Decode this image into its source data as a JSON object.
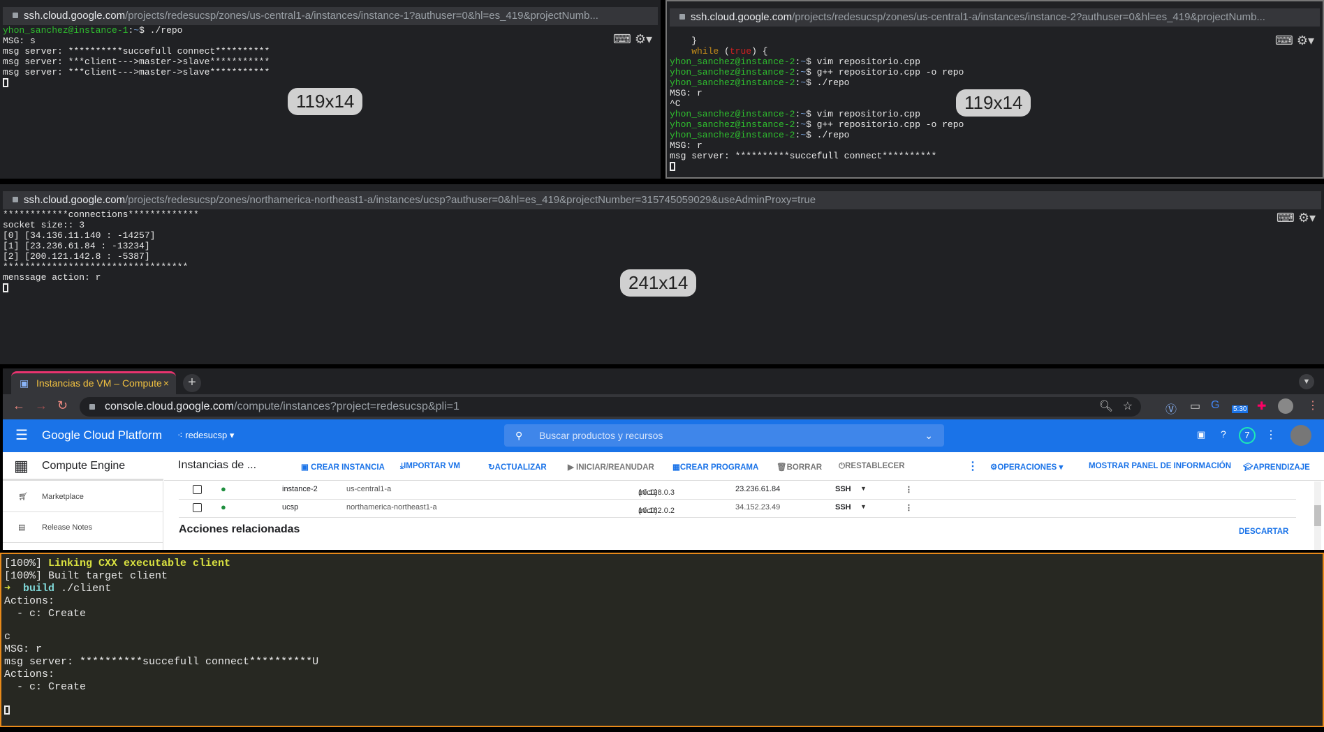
{
  "terminals": [
    {
      "id": "instance-1",
      "url_host": "ssh.cloud.google.com",
      "url_path": "/projects/redesucsp/zones/us-central1-a/instances/instance-1?authuser=0&hl=es_419&projectNumb...",
      "size_badge": "119x14",
      "lines": [
        [
          [
            "yhon_sanchez@instance-1",
            "g"
          ],
          [
            ":",
            ""
          ],
          [
            "~",
            "b"
          ],
          [
            "$ ./repo",
            ""
          ]
        ],
        [
          [
            "MSG: s",
            ""
          ]
        ],
        [
          [
            "msg server: **********succefull connect**********",
            ""
          ]
        ],
        [
          [
            "msg server: ***client--->master->slave***********",
            ""
          ]
        ],
        [
          [
            "msg server: ***client--->master->slave***********",
            ""
          ]
        ]
      ]
    },
    {
      "id": "instance-2",
      "url_host": "ssh.cloud.google.com",
      "url_path": "/projects/redesucsp/zones/us-central1-a/instances/instance-2?authuser=0&hl=es_419&projectNumb...",
      "size_badge": "119x14",
      "lines": [
        [
          [
            "",
            ""
          ]
        ],
        [
          [
            "    }",
            ""
          ]
        ],
        [
          [
            "    ",
            ""
          ],
          [
            "while",
            "o"
          ],
          [
            " (",
            ""
          ],
          [
            "true",
            "r"
          ],
          [
            ") {",
            ""
          ]
        ],
        [
          [
            "yhon_sanchez@instance-2",
            "g"
          ],
          [
            ":",
            ""
          ],
          [
            "~",
            "b"
          ],
          [
            "$ vim repositorio.cpp",
            ""
          ]
        ],
        [
          [
            "yhon_sanchez@instance-2",
            "g"
          ],
          [
            ":",
            ""
          ],
          [
            "~",
            "b"
          ],
          [
            "$ g++ repositorio.cpp -o repo",
            ""
          ]
        ],
        [
          [
            "yhon_sanchez@instance-2",
            "g"
          ],
          [
            ":",
            ""
          ],
          [
            "~",
            "b"
          ],
          [
            "$ ./repo",
            ""
          ]
        ],
        [
          [
            "MSG: r",
            ""
          ]
        ],
        [
          [
            "^C",
            ""
          ]
        ],
        [
          [
            "yhon_sanchez@instance-2",
            "g"
          ],
          [
            ":",
            ""
          ],
          [
            "~",
            "b"
          ],
          [
            "$ vim repositorio.cpp",
            ""
          ]
        ],
        [
          [
            "yhon_sanchez@instance-2",
            "g"
          ],
          [
            ":",
            ""
          ],
          [
            "~",
            "b"
          ],
          [
            "$ g++ repositorio.cpp -o repo",
            ""
          ]
        ],
        [
          [
            "yhon_sanchez@instance-2",
            "g"
          ],
          [
            ":",
            ""
          ],
          [
            "~",
            "b"
          ],
          [
            "$ ./repo",
            ""
          ]
        ],
        [
          [
            "MSG: r",
            ""
          ]
        ],
        [
          [
            "msg server: **********succefull connect**********",
            ""
          ]
        ]
      ]
    },
    {
      "id": "ucsp",
      "url_host": "ssh.cloud.google.com",
      "url_path": "/projects/redesucsp/zones/northamerica-northeast1-a/instances/ucsp?authuser=0&hl=es_419&projectNumber=315745059029&useAdminProxy=true",
      "size_badge": "241x14",
      "lines": [
        [
          [
            "************connections*************",
            ""
          ]
        ],
        [
          [
            "socket size:: 3",
            ""
          ]
        ],
        [
          [
            "[0] [34.136.11.140 : -14257]",
            ""
          ]
        ],
        [
          [
            "[1] [23.236.61.84 : -13234]",
            ""
          ]
        ],
        [
          [
            "[2] [200.121.142.8 : -5387]",
            ""
          ]
        ],
        [
          [
            "**********************************",
            ""
          ]
        ],
        [
          [
            "menssage action: r",
            ""
          ]
        ]
      ]
    }
  ],
  "browser": {
    "tab_title": "Instancias de VM – Compute",
    "url_host": "console.cloud.google.com",
    "url_path": "/compute/instances?project=redesucsp&pli=1",
    "ext_badge": "5:30",
    "brand": "Google Cloud Platform",
    "project": "redesucsp",
    "search_placeholder": "Buscar productos y recursos",
    "notifications": "7",
    "product": "Compute Engine",
    "sidebar": [
      "Marketplace",
      "Release Notes"
    ],
    "page_title": "Instancias de ...",
    "actions": [
      "CREAR INSTANCIA",
      "IMPORTAR VM",
      "ACTUALIZAR",
      "INICIAR/REANUDAR",
      "CREAR PROGRAMA",
      "BORRAR",
      "RESTABLECER",
      "OPERACIONES",
      "MOSTRAR PANEL DE INFORMACIÓN",
      "APRENDIZAJE"
    ],
    "rows": [
      {
        "name": "instance-2",
        "zone": "us-central1-a",
        "internal_ip": "10.128.0.3",
        "nic": "(nic0)",
        "external_ip": "23.236.61.84",
        "connect": "SSH"
      },
      {
        "name": "ucsp",
        "zone": "northamerica-northeast1-a",
        "internal_ip": "10.162.0.2",
        "nic": "(nic0)",
        "external_ip": "34.152.23.49",
        "connect": "SSH"
      }
    ],
    "related_title": "Acciones relacionadas",
    "dismiss": "DESCARTAR"
  },
  "bottom_terminal": {
    "lines": [
      [
        [
          "[100%] ",
          ""
        ],
        [
          "Linking CXX executable client",
          "y"
        ]
      ],
      [
        [
          "[100%] Built target client",
          ""
        ]
      ],
      [
        [
          "➜  ",
          "y"
        ],
        [
          "build",
          "c"
        ],
        [
          " ./client",
          ""
        ]
      ],
      [
        [
          "Actions:",
          ""
        ]
      ],
      [
        [
          "  - c: Create",
          ""
        ]
      ],
      [
        [
          "",
          ""
        ]
      ],
      [
        [
          "c",
          ""
        ]
      ],
      [
        [
          "MSG: r",
          ""
        ]
      ],
      [
        [
          "msg server: **********succefull connect**********U",
          ""
        ]
      ],
      [
        [
          "Actions:",
          ""
        ]
      ],
      [
        [
          "  - c: Create",
          ""
        ]
      ],
      [
        [
          "",
          ""
        ]
      ]
    ]
  },
  "colors": {
    "gcp_blue": "#1a73e8",
    "terminal_bg": "#202124",
    "prompt_green": "#2fbf2f",
    "active_border": "#e88a1a"
  }
}
